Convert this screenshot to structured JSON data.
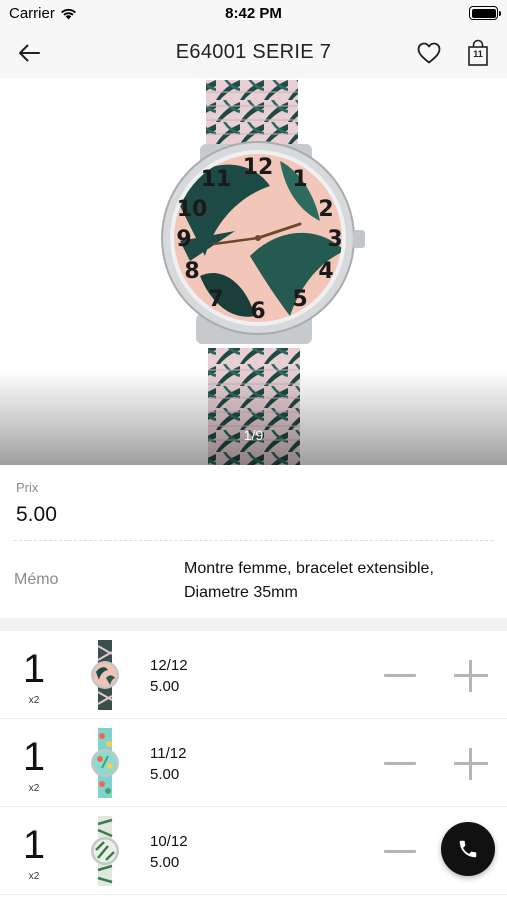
{
  "status_bar": {
    "carrier": "Carrier",
    "time": "8:42 PM",
    "battery_level": 1.0
  },
  "nav": {
    "title": "E64001 SERIE 7",
    "back_icon": "arrow-left-icon",
    "favorite_icon": "heart-icon",
    "cart_icon": "shopping-bag-icon",
    "cart_count": "11"
  },
  "gallery": {
    "counter": "1/9"
  },
  "product": {
    "price_label": "Prix",
    "price": "5.00",
    "memo_label": "Mémo",
    "memo": "Montre femme, bracelet extensible, Diametre 35mm"
  },
  "variants": [
    {
      "quantity": "1",
      "pack": "x2",
      "size": "12/12",
      "price": "5.00",
      "theme": "dark-tropical"
    },
    {
      "quantity": "1",
      "pack": "x2",
      "size": "11/12",
      "price": "5.00",
      "theme": "aqua-fruit"
    },
    {
      "quantity": "1",
      "pack": "x2",
      "size": "10/12",
      "price": "5.00",
      "theme": "green-floral"
    }
  ],
  "fab": {
    "icon": "phone-icon"
  },
  "colors": {
    "bar_background": "#f7f7f7",
    "stepper": "#b5b5b5",
    "fab": "#111111"
  }
}
